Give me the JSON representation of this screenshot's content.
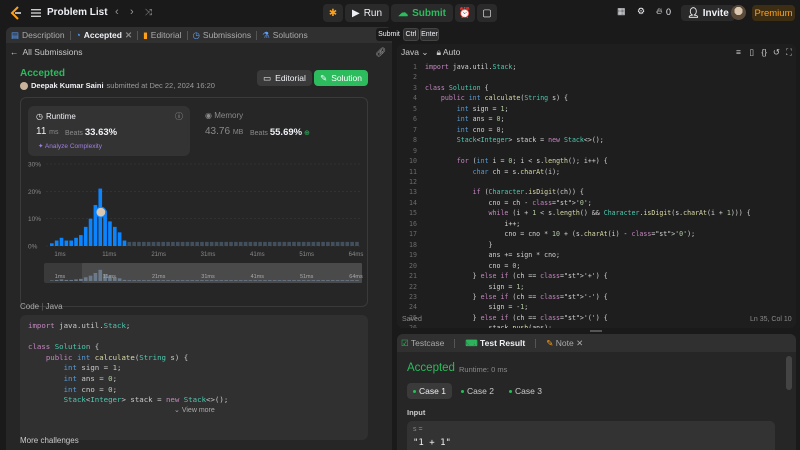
{
  "topbar": {
    "title": "Problem List",
    "run_label": "Run",
    "submit_label": "Submit",
    "invite_label": "Invite",
    "premium_label": "Premium",
    "streak_count": "0"
  },
  "left_tabs": [
    {
      "label": "Description"
    },
    {
      "label": "Accepted"
    },
    {
      "label": "Editorial"
    },
    {
      "label": "Submissions"
    },
    {
      "label": "Solutions"
    }
  ],
  "back_label": "All Submissions",
  "result": {
    "status": "Accepted",
    "author": "Deepak Kumar Saini",
    "submitted_text": "submitted at Dec 22, 2024 16:20",
    "editorial_label": "Editorial",
    "solution_label": "Solution"
  },
  "runtime": {
    "title": "Runtime",
    "value": "11",
    "unit": "ms",
    "beats_label": "Beats",
    "beats_value": "33.63%",
    "analyze_label": "Analyze Complexity"
  },
  "memory": {
    "title": "Memory",
    "value": "43.76",
    "unit": "MB",
    "beats_label": "Beats",
    "beats_value": "55.69%"
  },
  "chart_data": {
    "type": "bar",
    "ylim": [
      0,
      30
    ],
    "yticks": [
      "30%",
      "20%",
      "10%",
      "0%"
    ],
    "xticks": [
      "1ms",
      "11ms",
      "21ms",
      "31ms",
      "41ms",
      "51ms",
      "64ms"
    ],
    "minimap_xticks": [
      "1ms",
      "11ms",
      "21ms",
      "31ms",
      "41ms",
      "51ms",
      "64ms"
    ],
    "values": [
      1,
      2,
      3,
      2,
      2,
      3,
      4,
      7,
      10,
      15,
      21,
      13,
      9,
      7,
      5,
      2,
      1.5,
      1.5,
      1.5,
      1.5,
      1.5,
      1.5,
      1.5,
      1.5,
      1.5,
      1.5,
      1.5,
      1.5,
      1.5,
      1.5,
      1.5,
      1.5,
      1.5,
      1.5,
      1.5,
      1.5,
      1.5,
      1.5,
      1.5,
      1.5,
      1.5,
      1.5,
      1.5,
      1.5,
      1.5,
      1.5,
      1.5,
      1.5,
      1.5,
      1.5,
      1.5,
      1.5,
      1.5,
      1.5,
      1.5,
      1.5,
      1.5,
      1.5,
      1.5,
      1.5,
      1.5,
      1.5,
      1.5,
      1.5
    ],
    "highlight_index": 10,
    "colors": {
      "bar": "#0a84ff",
      "highlight": "#0a84ff",
      "minor": "#4a5a6a"
    }
  },
  "code_section": {
    "title": "Code",
    "language": "Java",
    "lines": [
      "import java.util.Stack;",
      "",
      "class Solution {",
      "    public int calculate(String s) {",
      "        int sign = 1;",
      "        int ans = 0;",
      "        int cno = 0;",
      "        Stack<Integer> stack = new Stack<>();"
    ],
    "view_more": "View more"
  },
  "more_challenges": "More challenges",
  "editor": {
    "language": "Java",
    "auto_label": "Auto",
    "line_numbers": [
      "1",
      "2",
      "3",
      "4",
      "5",
      "6",
      "7",
      "8",
      "9",
      "10",
      "11",
      "12",
      "13",
      "14",
      "15",
      "16",
      "17",
      "18",
      "19",
      "20",
      "21",
      "22",
      "23",
      "24",
      "25",
      "26"
    ],
    "lines": [
      "import java.util.Stack;",
      "",
      "class Solution {",
      "    public int calculate(String s) {",
      "        int sign = 1;",
      "        int ans = 0;",
      "        int cno = 0;",
      "        Stack<Integer> stack = new Stack<>();",
      "",
      "        for (int i = 0; i < s.length(); i++) {",
      "            char ch = s.charAt(i);",
      "",
      "            if (Character.isDigit(ch)) {",
      "                cno = ch - '0';",
      "                while (i + 1 < s.length() && Character.isDigit(s.charAt(i + 1))) {",
      "                    i++;",
      "                    cno = cno * 10 + (s.charAt(i) - '0');",
      "                }",
      "                ans += sign * cno;",
      "                cno = 0;",
      "            } else if (ch == '+') {",
      "                sign = 1;",
      "            } else if (ch == '-') {",
      "                sign = -1;",
      "            } else if (ch == '(') {",
      "                stack.push(ans);"
    ],
    "saved_label": "Saved",
    "cursor_pos": "Ln 35, Col 10",
    "tooltip_submit": "Submit",
    "tooltip_ctrl": "Ctrl",
    "tooltip_enter": "Enter"
  },
  "bottom_tabs": [
    {
      "label": "Testcase"
    },
    {
      "label": "Test Result"
    },
    {
      "label": "Note"
    }
  ],
  "test_result": {
    "status": "Accepted",
    "runtime": "Runtime: 0 ms",
    "cases": [
      "Case 1",
      "Case 2",
      "Case 3"
    ],
    "input_label": "Input",
    "var_name": "s =",
    "var_value": "\"1 + 1\""
  }
}
